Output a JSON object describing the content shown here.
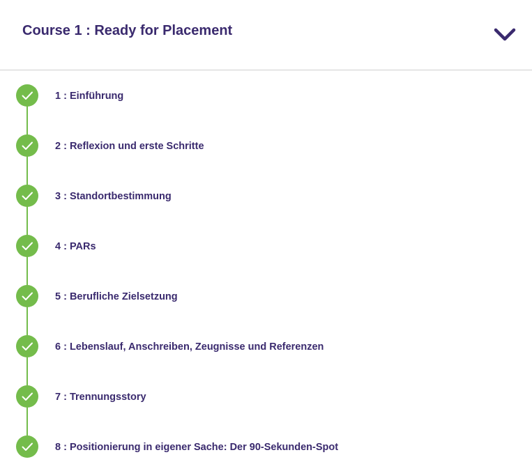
{
  "course": {
    "title": "Course 1 : Ready for Placement",
    "toggle_icon": "chevron-down-icon"
  },
  "colors": {
    "title": "#3a2a6e",
    "complete": "#74bc4b",
    "divider": "#cfcfcf"
  },
  "lessons": [
    {
      "label": "1 : Einführung",
      "status": "completed",
      "icon": "check-circle-icon"
    },
    {
      "label": "2 : Reflexion und erste Schritte",
      "status": "completed",
      "icon": "check-circle-icon"
    },
    {
      "label": "3 : Standortbestimmung",
      "status": "completed",
      "icon": "check-circle-icon"
    },
    {
      "label": "4 : PARs",
      "status": "completed",
      "icon": "check-circle-icon"
    },
    {
      "label": "5 : Berufliche Zielsetzung",
      "status": "completed",
      "icon": "check-circle-icon"
    },
    {
      "label": "6 : Lebenslauf, Anschreiben, Zeugnisse und Referenzen",
      "status": "completed",
      "icon": "check-circle-icon"
    },
    {
      "label": "7 : Trennungsstory",
      "status": "completed",
      "icon": "check-circle-icon"
    },
    {
      "label": "8 : Positionierung in eigener Sache: Der 90-Sekunden-Spot",
      "status": "completed",
      "icon": "check-circle-icon"
    }
  ]
}
